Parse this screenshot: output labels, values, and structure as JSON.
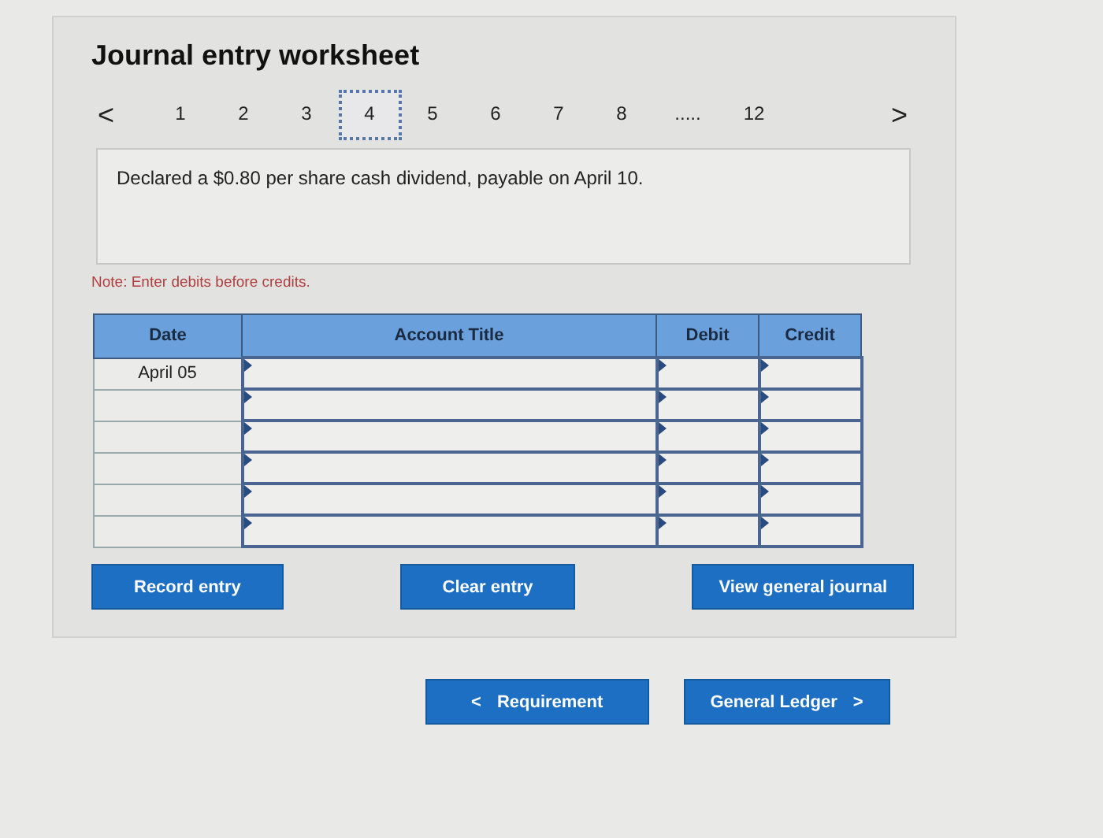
{
  "title": "Journal entry worksheet",
  "pager": {
    "prev": "<",
    "next": ">",
    "pages": [
      {
        "label": "1",
        "selected": false
      },
      {
        "label": "2",
        "selected": false
      },
      {
        "label": "3",
        "selected": false
      },
      {
        "label": "4",
        "selected": true
      },
      {
        "label": "5",
        "selected": false
      },
      {
        "label": "6",
        "selected": false
      },
      {
        "label": "7",
        "selected": false
      },
      {
        "label": "8",
        "selected": false
      },
      {
        "label": ".....",
        "kind": "ellipsis",
        "selected": false
      },
      {
        "label": "12",
        "selected": false
      }
    ]
  },
  "question": "Declared a $0.80 per share cash dividend, payable on April 10.",
  "note": "Note: Enter debits before credits.",
  "table": {
    "columns": [
      "Date",
      "Account Title",
      "Debit",
      "Credit"
    ],
    "rows": [
      {
        "date": "April 05"
      },
      {},
      {},
      {},
      {},
      {}
    ]
  },
  "actions": [
    "Record entry",
    "Clear entry",
    "View general journal"
  ],
  "nav": {
    "back": {
      "arrow": "<",
      "label": "Requirement"
    },
    "forward": {
      "label": "General Ledger",
      "arrow": ">"
    }
  }
}
